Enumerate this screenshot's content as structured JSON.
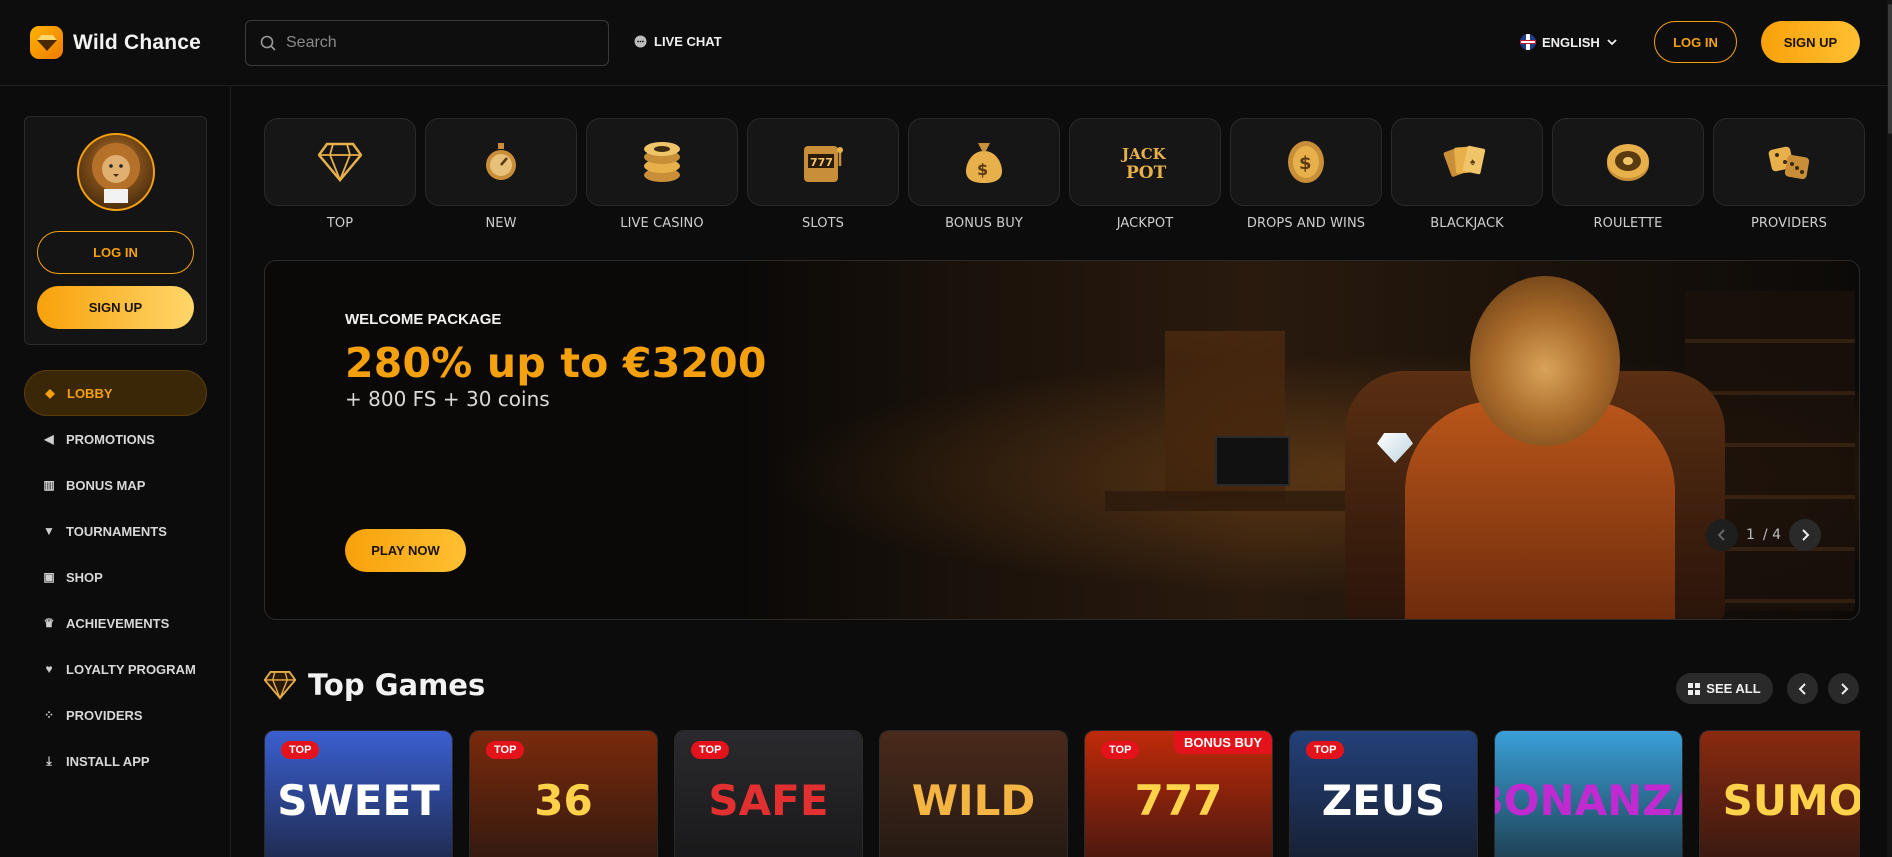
{
  "header": {
    "brand": "Wild Chance",
    "search_placeholder": "Search",
    "live_chat": "LIVE CHAT",
    "language": "ENGLISH",
    "login": "LOG IN",
    "signup": "SIGN UP"
  },
  "sidebar": {
    "login": "LOG IN",
    "signup": "SIGN UP",
    "items": [
      {
        "label": "LOBBY",
        "icon": "cube-icon",
        "active": true
      },
      {
        "label": "PROMOTIONS",
        "icon": "megaphone-icon",
        "active": false
      },
      {
        "label": "BONUS MAP",
        "icon": "map-icon",
        "active": false
      },
      {
        "label": "TOURNAMENTS",
        "icon": "trophy-icon",
        "active": false
      },
      {
        "label": "SHOP",
        "icon": "shop-icon",
        "active": false
      },
      {
        "label": "ACHIEVEMENTS",
        "icon": "crown-icon",
        "active": false
      },
      {
        "label": "LOYALTY PROGRAM",
        "icon": "heart-icon",
        "active": false
      },
      {
        "label": "PROVIDERS",
        "icon": "grid-icon",
        "active": false
      },
      {
        "label": "INSTALL APP",
        "icon": "download-icon",
        "active": false
      }
    ]
  },
  "categories": [
    {
      "label": "TOP",
      "icon": "diamond-icon"
    },
    {
      "label": "NEW",
      "icon": "stopwatch-icon"
    },
    {
      "label": "LIVE CASINO",
      "icon": "chip-icon"
    },
    {
      "label": "SLOTS",
      "icon": "slot-machine-icon"
    },
    {
      "label": "BONUS BUY",
      "icon": "money-bag-icon"
    },
    {
      "label": "JACKPOT",
      "icon": "jackpot-icon"
    },
    {
      "label": "DROPS AND WINS",
      "icon": "coin-icon"
    },
    {
      "label": "BLACKJACK",
      "icon": "cards-icon"
    },
    {
      "label": "ROULETTE",
      "icon": "roulette-icon"
    },
    {
      "label": "PROVIDERS",
      "icon": "dice-icon"
    }
  ],
  "banner": {
    "subtitle": "WELCOME PACKAGE",
    "title": "280% up to €3200",
    "extra": "+ 800 FS + 30 coins",
    "cta": "PLAY NOW",
    "pager_current": "1",
    "pager_total": "/ 4"
  },
  "top_games": {
    "title": "Top Games",
    "see_all": "SEE ALL",
    "games": [
      {
        "name": "gumball-egg",
        "tag": "TOP",
        "bonus": "",
        "art": "SWEET",
        "bg": "#3a5fd0",
        "color": "#ffffff"
      },
      {
        "name": "36-coins",
        "tag": "TOP",
        "bonus": "",
        "art": "36",
        "bg": "#7a2a0c",
        "color": "#ffd24a"
      },
      {
        "name": "red-safe",
        "tag": "TOP",
        "bonus": "",
        "art": "SAFE",
        "bg": "#2a2a2e",
        "color": "#e23030"
      },
      {
        "name": "cactus-cowboy",
        "tag": "",
        "bonus": "",
        "art": "WILD",
        "bg": "#4a2a1a",
        "color": "#f5b542"
      },
      {
        "name": "777-ultra",
        "tag": "TOP",
        "bonus": "BONUS BUY",
        "art": "777",
        "bg": "#c02a0a",
        "color": "#ffd24a"
      },
      {
        "name": "zeus",
        "tag": "TOP",
        "bonus": "",
        "art": "ZEUS",
        "bg": "#23407a",
        "color": "#ffffff"
      },
      {
        "name": "bonanza-billion",
        "tag": "",
        "bonus": "",
        "art": "BONANZA",
        "bg": "#3aa0d8",
        "color": "#c02ad0"
      },
      {
        "name": "sumo",
        "tag": "",
        "bonus": "",
        "art": "SUMO",
        "bg": "#8a2a10",
        "color": "#ffd24a"
      }
    ]
  }
}
